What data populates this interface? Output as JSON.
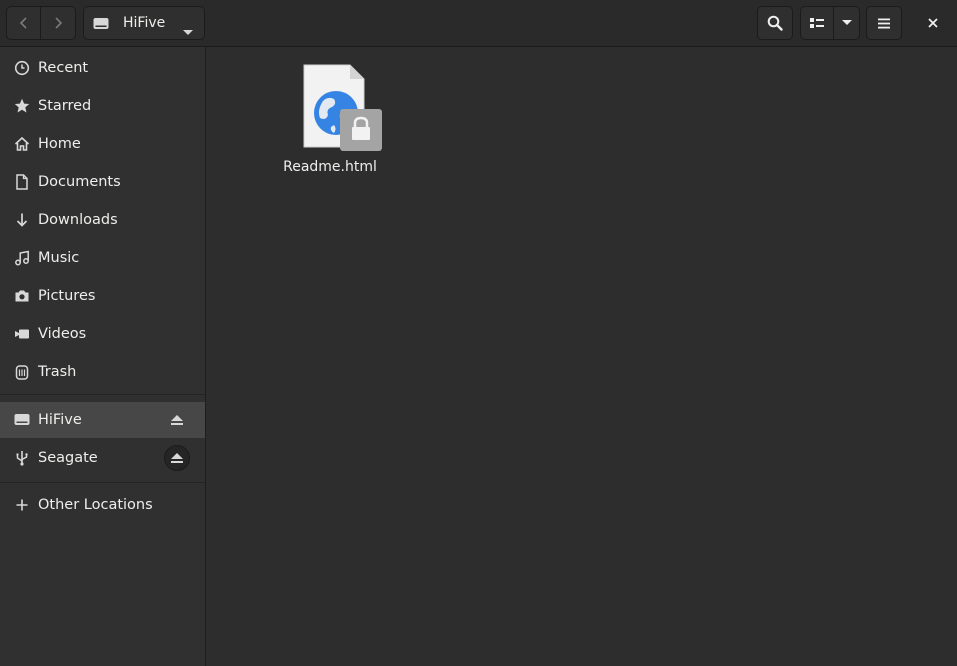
{
  "header": {
    "location": "HiFive",
    "icons": {
      "back": "chevron-left-icon",
      "forward": "chevron-right-icon",
      "drive": "drive-icon",
      "dropdown": "chevron-down-icon",
      "search": "search-icon",
      "view": "list-view-icon",
      "menu": "hamburger-menu-icon",
      "close": "close-icon"
    }
  },
  "sidebar": {
    "places": [
      {
        "label": "Recent",
        "icon": "clock-icon"
      },
      {
        "label": "Starred",
        "icon": "star-icon"
      },
      {
        "label": "Home",
        "icon": "home-icon"
      },
      {
        "label": "Documents",
        "icon": "document-icon"
      },
      {
        "label": "Downloads",
        "icon": "download-icon"
      },
      {
        "label": "Music",
        "icon": "music-icon"
      },
      {
        "label": "Pictures",
        "icon": "camera-icon"
      },
      {
        "label": "Videos",
        "icon": "video-icon"
      },
      {
        "label": "Trash",
        "icon": "trash-icon"
      }
    ],
    "devices": [
      {
        "label": "HiFive",
        "icon": "drive-icon",
        "active": true
      },
      {
        "label": "Seagate",
        "icon": "usb-icon",
        "active": false
      }
    ],
    "other": {
      "label": "Other Locations",
      "icon": "plus-icon"
    }
  },
  "files": [
    {
      "name": "Readme.html",
      "icon": "html-file-icon",
      "emblem": "lock-icon"
    }
  ],
  "colors": {
    "accent_blue": "#3584e4",
    "background": "#2d2d2d",
    "sidebar": "#303030",
    "active_row": "#474747"
  }
}
